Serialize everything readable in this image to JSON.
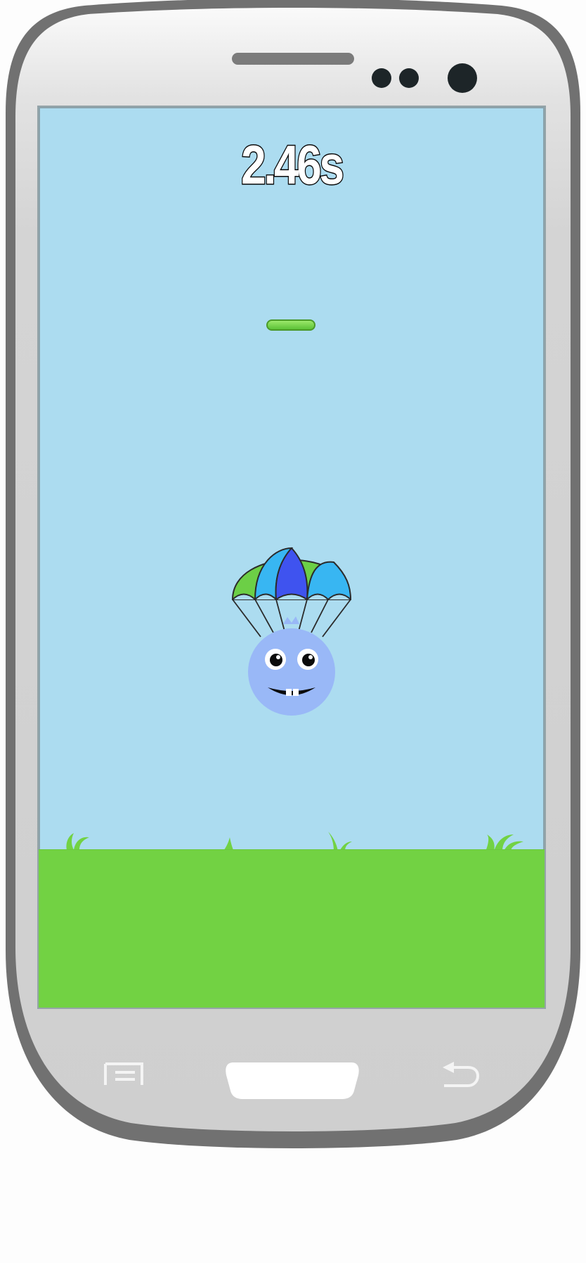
{
  "game": {
    "timer_text": "2.46s"
  },
  "colors": {
    "sky": "#acdcf0",
    "ground": "#72d243",
    "platform": "#6fd043",
    "player_body": "#99b8f7",
    "device_frame": "#717171",
    "device_body": "#d1d1d1"
  },
  "icons": {
    "menu": "menu-icon",
    "home": "home-button",
    "back": "back-icon"
  }
}
